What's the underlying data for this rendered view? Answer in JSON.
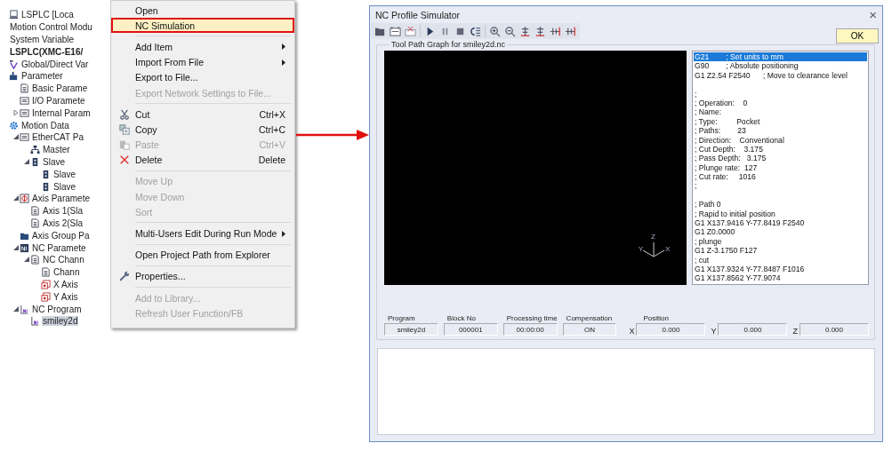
{
  "tree": [
    {
      "label": "LSPLC [Loca",
      "kind": "plc"
    },
    {
      "label": "Motion Control Modu",
      "kind": "none"
    },
    {
      "label": "System Variable",
      "kind": "none"
    },
    {
      "label": "LSPLC(XMC-E16/",
      "kind": "none",
      "bold": true
    },
    {
      "label": "Global/Direct Var",
      "kind": "var"
    },
    {
      "label": "Parameter",
      "kind": "param",
      "children": [
        {
          "label": "Basic Parame",
          "kind": "doc"
        },
        {
          "label": "I/O Paramete",
          "kind": "module"
        },
        {
          "label": "Internal Param",
          "kind": "module",
          "expanded": false
        }
      ]
    },
    {
      "label": "Motion Data",
      "kind": "gear",
      "children": [
        {
          "label": "EtherCAT Pa",
          "kind": "module",
          "expanded": true,
          "children": [
            {
              "label": "Master",
              "kind": "network"
            },
            {
              "label": "Slave",
              "kind": "slave",
              "expanded": true,
              "children": [
                {
                  "label": "Slave",
                  "kind": "slave"
                },
                {
                  "label": "Slave",
                  "kind": "slave"
                }
              ]
            }
          ]
        },
        {
          "label": "Axis Paramete",
          "kind": "axis",
          "expanded": true,
          "children": [
            {
              "label": "Axis 1(Sla",
              "kind": "doc"
            },
            {
              "label": "Axis 2(Sla",
              "kind": "doc"
            }
          ]
        },
        {
          "label": "Axis Group Pa",
          "kind": "group"
        },
        {
          "label": "NC Paramete",
          "kind": "ncfolder",
          "expanded": true,
          "children": [
            {
              "label": "NC Chann",
              "kind": "doc",
              "expanded": true,
              "children": [
                {
                  "label": "Chann",
                  "kind": "doc"
                },
                {
                  "label": "X Axis",
                  "kind": "axisdoc"
                },
                {
                  "label": "Y Axis",
                  "kind": "axisdoc"
                }
              ]
            }
          ]
        },
        {
          "label": "NC Program",
          "kind": "nc",
          "expanded": true,
          "children": [
            {
              "label": "smiley2d",
              "kind": "nc",
              "selected": true
            }
          ]
        }
      ]
    }
  ],
  "menu": [
    {
      "kind": "item",
      "label": "Open",
      "disabled": false,
      "selected": false,
      "annotated": false
    },
    {
      "kind": "item",
      "label": "NC Simulation",
      "disabled": false,
      "selected": true,
      "annotated": true
    },
    {
      "kind": "separator"
    },
    {
      "kind": "item",
      "label": "Add Item",
      "disabled": false,
      "selected": false,
      "annotated": false,
      "submenu": true
    },
    {
      "kind": "item",
      "label": "Import From File",
      "disabled": false,
      "selected": false,
      "annotated": false,
      "submenu": true
    },
    {
      "kind": "item",
      "label": "Export to File...",
      "disabled": false,
      "selected": false,
      "annotated": false
    },
    {
      "kind": "item",
      "label": "Export Network Settings to File...",
      "disabled": true,
      "selected": false,
      "annotated": false
    },
    {
      "kind": "separator"
    },
    {
      "kind": "cut",
      "label": "Cut",
      "shortcut": "Ctrl+X",
      "disabled": false,
      "selected": false,
      "annotated": false
    },
    {
      "kind": "copy",
      "label": "Copy",
      "shortcut": "Ctrl+C",
      "disabled": false,
      "selected": false,
      "annotated": false
    },
    {
      "kind": "paste",
      "label": "Paste",
      "shortcut": "Ctrl+V",
      "disabled": true,
      "selected": false,
      "annotated": false
    },
    {
      "kind": "delete",
      "label": "Delete",
      "shortcut": "Delete",
      "disabled": false,
      "selected": false,
      "annotated": false
    },
    {
      "kind": "separator"
    },
    {
      "kind": "item",
      "label": "Move Up",
      "disabled": true,
      "selected": false,
      "annotated": false
    },
    {
      "kind": "item",
      "label": "Move Down",
      "disabled": true,
      "selected": false,
      "annotated": false
    },
    {
      "kind": "item",
      "label": "Sort",
      "disabled": true,
      "selected": false,
      "annotated": false
    },
    {
      "kind": "separator"
    },
    {
      "kind": "item",
      "label": "Multi-Users Edit During Run Mode",
      "disabled": false,
      "selected": false,
      "annotated": false,
      "submenu": true
    },
    {
      "kind": "separator"
    },
    {
      "kind": "item",
      "label": "Open Project Path from Explorer",
      "disabled": false,
      "selected": false,
      "annotated": false
    },
    {
      "kind": "separator"
    },
    {
      "kind": "properties",
      "label": "Properties...",
      "disabled": false,
      "selected": false,
      "annotated": false
    },
    {
      "kind": "separator"
    },
    {
      "kind": "item",
      "label": "Add to Library...",
      "disabled": true,
      "selected": false,
      "annotated": false
    },
    {
      "kind": "item",
      "label": "Refresh User Function/FB",
      "disabled": true,
      "selected": false,
      "annotated": false
    }
  ],
  "window": {
    "title": "NC Profile Simulator",
    "close": "×"
  },
  "toolbar": [
    {
      "kind": "open"
    },
    {
      "kind": "load"
    },
    {
      "kind": "unload"
    },
    {
      "kind": "sep"
    },
    {
      "kind": "play"
    },
    {
      "kind": "pause"
    },
    {
      "kind": "stop"
    },
    {
      "kind": "step"
    },
    {
      "kind": "sep"
    },
    {
      "kind": "zoom-in"
    },
    {
      "kind": "zoom-out"
    },
    {
      "kind": "align-up"
    },
    {
      "kind": "align-down"
    },
    {
      "kind": "align-left"
    },
    {
      "kind": "align-right"
    }
  ],
  "ok_button": "OK",
  "graph": {
    "title": "Tool Path Graph for smiley2d.nc",
    "axes": [
      "Z",
      "Y",
      "X"
    ]
  },
  "code_lines": [
    {
      "kind": "line",
      "text": "G21        ; Set units to mm",
      "selected": true
    },
    {
      "kind": "line",
      "text": "G90        ; Absolute positioning",
      "selected": false
    },
    {
      "kind": "line",
      "text": "G1 Z2.54 F2540      ; Move to clearance level",
      "selected": false
    },
    {
      "kind": "blank",
      "selected": false
    },
    {
      "kind": "line",
      "text": ";",
      "selected": false
    },
    {
      "kind": "line",
      "text": "; Operation:    0",
      "selected": false
    },
    {
      "kind": "line",
      "text": "; Name:",
      "selected": false
    },
    {
      "kind": "line",
      "text": "; Type:         Pocket",
      "selected": false
    },
    {
      "kind": "line",
      "text": "; Paths:        23",
      "selected": false
    },
    {
      "kind": "line",
      "text": "; Direction:    Conventional",
      "selected": false
    },
    {
      "kind": "line",
      "text": "; Cut Depth:    3.175",
      "selected": false
    },
    {
      "kind": "line",
      "text": "; Pass Depth:   3.175",
      "selected": false
    },
    {
      "kind": "line",
      "text": "; Plunge rate:  127",
      "selected": false
    },
    {
      "kind": "line",
      "text": "; Cut rate:     1016",
      "selected": false
    },
    {
      "kind": "line",
      "text": ";",
      "selected": false
    },
    {
      "kind": "blank",
      "selected": false
    },
    {
      "kind": "line",
      "text": "; Path 0",
      "selected": false
    },
    {
      "kind": "line",
      "text": "; Rapid to initial position",
      "selected": false
    },
    {
      "kind": "line",
      "text": "G1 X137.9416 Y-77.8419 F2540",
      "selected": false
    },
    {
      "kind": "line",
      "text": "G1 Z0.0000",
      "selected": false
    },
    {
      "kind": "line",
      "text": "; plunge",
      "selected": false
    },
    {
      "kind": "line",
      "text": "G1 Z-3.1750 F127",
      "selected": false
    },
    {
      "kind": "line",
      "text": "; cut",
      "selected": false
    },
    {
      "kind": "line",
      "text": "G1 X137.9324 Y-77.8487 F1016",
      "selected": false
    },
    {
      "kind": "line",
      "text": "G1 X137.8562 Y-77.9074",
      "selected": false
    }
  ],
  "status": [
    {
      "label": "Program",
      "value": "smiley2d"
    },
    {
      "label": "Block No",
      "value": "000001"
    },
    {
      "label": "Processing time",
      "value": "00:00:00"
    },
    {
      "label": "Compensation",
      "value": "ON"
    }
  ],
  "position": {
    "label": "Position",
    "axes": [
      {
        "axis": "X",
        "value": "0.000"
      },
      {
        "axis": "Y",
        "value": "0.000"
      },
      {
        "axis": "Z",
        "value": "0.000"
      }
    ]
  }
}
